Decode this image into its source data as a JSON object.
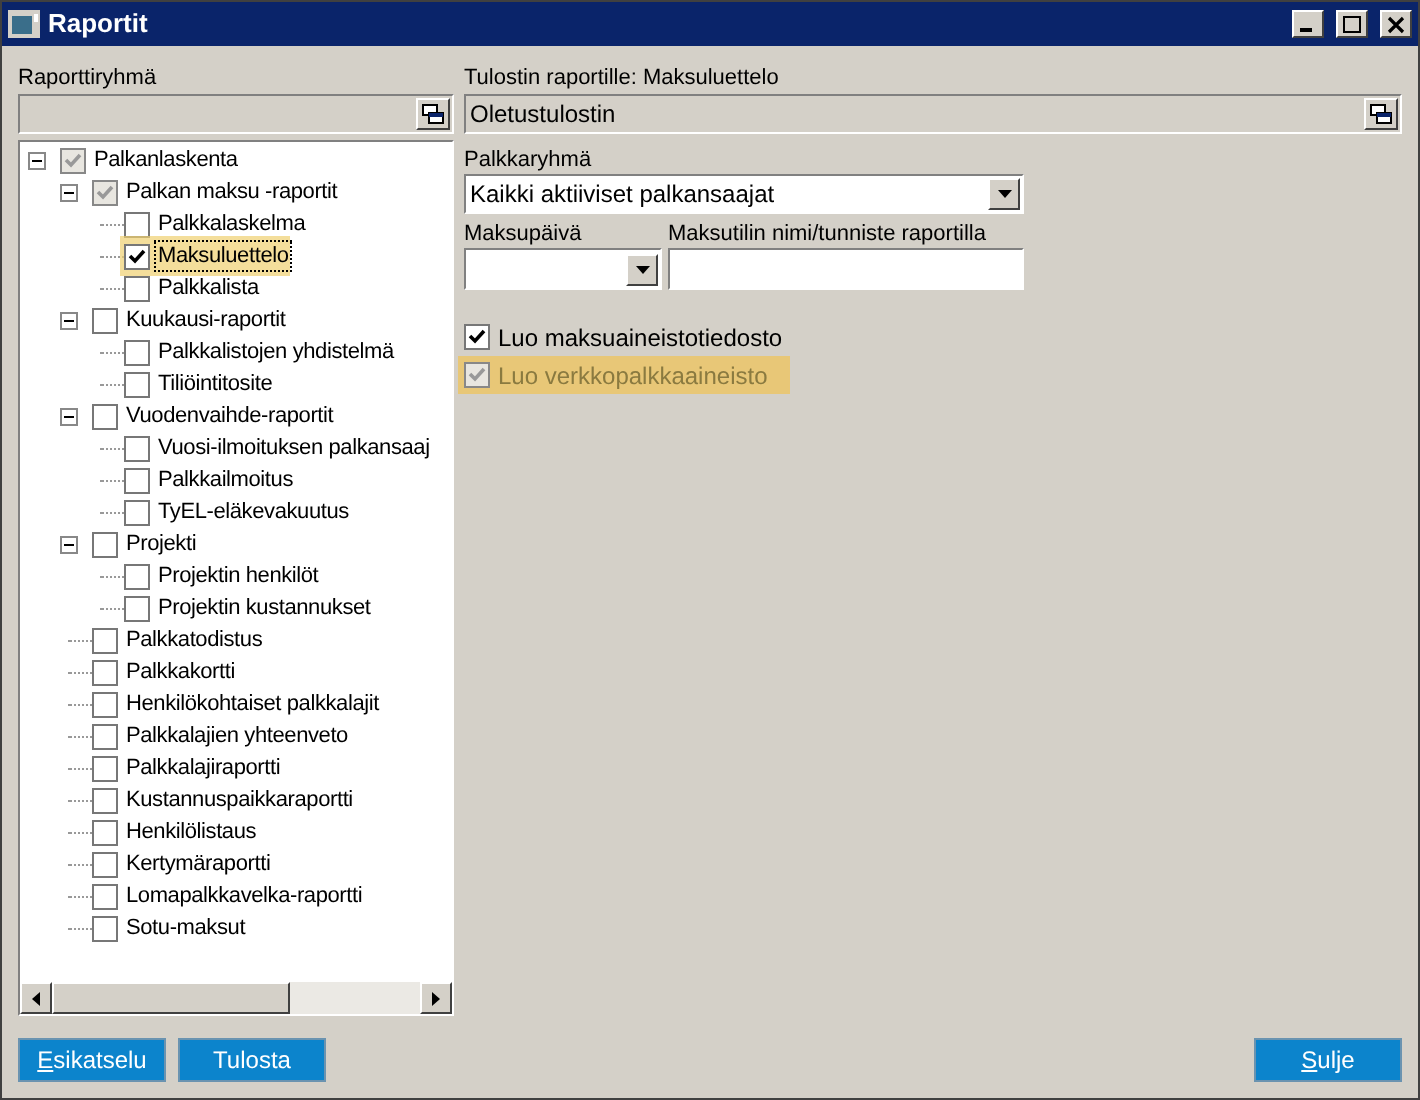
{
  "window": {
    "title": "Raportit"
  },
  "report_group": {
    "label": "Raporttiryhmä"
  },
  "tree": [
    {
      "label": "Palkanlaskenta",
      "checked": true,
      "grayed": true,
      "highlighted": false,
      "selected": false,
      "expanded": true,
      "children": [
        {
          "label": "Palkan maksu -raportit",
          "checked": true,
          "grayed": true,
          "highlighted": false,
          "selected": false,
          "expanded": true,
          "children": [
            {
              "label": "Palkkalaskelma",
              "checked": false,
              "grayed": false,
              "highlighted": false,
              "selected": false
            },
            {
              "label": "Maksuluettelo",
              "checked": true,
              "grayed": false,
              "highlighted": true,
              "selected": true
            },
            {
              "label": "Palkkalista",
              "checked": false,
              "grayed": false,
              "highlighted": false,
              "selected": false
            }
          ]
        },
        {
          "label": "Kuukausi-raportit",
          "checked": false,
          "grayed": false,
          "highlighted": false,
          "selected": false,
          "expanded": true,
          "children": [
            {
              "label": "Palkkalistojen yhdistelmä",
              "checked": false,
              "grayed": false,
              "highlighted": false,
              "selected": false
            },
            {
              "label": "Tiliöintitosite",
              "checked": false,
              "grayed": false,
              "highlighted": false,
              "selected": false
            }
          ]
        },
        {
          "label": "Vuodenvaihde-raportit",
          "checked": false,
          "grayed": false,
          "highlighted": false,
          "selected": false,
          "expanded": true,
          "children": [
            {
              "label": "Vuosi-ilmoituksen palkansaaj",
              "checked": false,
              "grayed": false,
              "highlighted": false,
              "selected": false
            },
            {
              "label": "Palkkailmoitus",
              "checked": false,
              "grayed": false,
              "highlighted": false,
              "selected": false
            },
            {
              "label": "TyEL-eläkevakuutus",
              "checked": false,
              "grayed": false,
              "highlighted": false,
              "selected": false
            }
          ]
        },
        {
          "label": "Projekti",
          "checked": false,
          "grayed": false,
          "highlighted": false,
          "selected": false,
          "expanded": true,
          "children": [
            {
              "label": "Projektin henkilöt",
              "checked": false,
              "grayed": false,
              "highlighted": false,
              "selected": false
            },
            {
              "label": "Projektin kustannukset",
              "checked": false,
              "grayed": false,
              "highlighted": false,
              "selected": false
            }
          ]
        },
        {
          "label": "Palkkatodistus",
          "checked": false,
          "grayed": false,
          "highlighted": false,
          "selected": false
        },
        {
          "label": "Palkkakortti",
          "checked": false,
          "grayed": false,
          "highlighted": false,
          "selected": false
        },
        {
          "label": "Henkilökohtaiset palkkalajit",
          "checked": false,
          "grayed": false,
          "highlighted": false,
          "selected": false
        },
        {
          "label": "Palkkalajien yhteenveto",
          "checked": false,
          "grayed": false,
          "highlighted": false,
          "selected": false
        },
        {
          "label": "Palkkalajiraportti",
          "checked": false,
          "grayed": false,
          "highlighted": false,
          "selected": false
        },
        {
          "label": "Kustannuspaikkaraportti",
          "checked": false,
          "grayed": false,
          "highlighted": false,
          "selected": false
        },
        {
          "label": "Henkilölistaus",
          "checked": false,
          "grayed": false,
          "highlighted": false,
          "selected": false
        },
        {
          "label": "Kertymäraportti",
          "checked": false,
          "grayed": false,
          "highlighted": false,
          "selected": false
        },
        {
          "label": "Lomapalkkavelka-raportti",
          "checked": false,
          "grayed": false,
          "highlighted": false,
          "selected": false
        },
        {
          "label": "Sotu-maksut",
          "checked": false,
          "grayed": false,
          "highlighted": false,
          "selected": false
        }
      ]
    }
  ],
  "printer": {
    "label": "Tulostin raportille: Maksuluettelo",
    "value": "Oletustulostin"
  },
  "pay_group": {
    "label": "Palkkaryhmä",
    "value": "Kaikki aktiiviset palkansaajat"
  },
  "payment_date": {
    "label": "Maksupäivä"
  },
  "account_name": {
    "label": "Maksutilin nimi/tunniste raportilla"
  },
  "options": [
    {
      "label": "Luo maksuaineistotiedosto",
      "checked": true,
      "disabled": false,
      "highlighted": false
    },
    {
      "label": "Luo verkkopalkkaaineisto",
      "checked": true,
      "disabled": true,
      "highlighted": true
    }
  ],
  "left_buttons": [
    {
      "label": "Esikatselu",
      "mnemonic": true
    },
    {
      "label": "Tulosta",
      "mnemonic": false
    }
  ],
  "right_buttons": [
    {
      "label": "Sulje",
      "mnemonic": true
    }
  ]
}
